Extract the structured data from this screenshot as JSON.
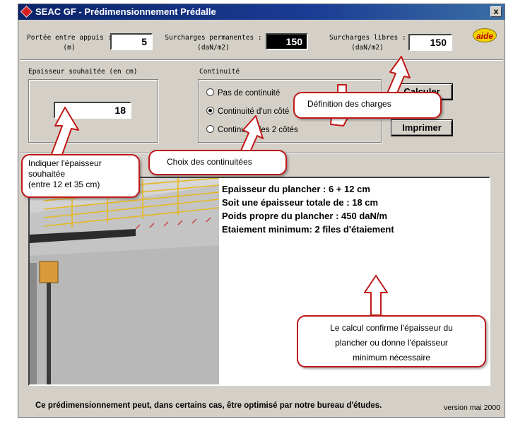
{
  "window": {
    "title": "SEAC GF - Prédimensionnement Prédalle",
    "close_label": "x"
  },
  "inputs": {
    "portee": {
      "label_line1": "Portée entre appuis :",
      "label_line2": "(m)",
      "value": "5"
    },
    "surcharges_permanentes": {
      "label_line1": "Surcharges permanentes :",
      "label_line2": "(daN/m2)",
      "value": "150"
    },
    "surcharges_libres": {
      "label_line1": "Surcharges libres :",
      "label_line2": "(daN/m2)",
      "value": "150"
    }
  },
  "aide_label": "aide",
  "epaisseur": {
    "label": "Epaisseur souhaitée (en cm)",
    "value": "18"
  },
  "continuite": {
    "label": "Continuité",
    "options": [
      {
        "label": "Pas de continuité",
        "selected": false
      },
      {
        "label": "Continuité d'un côté",
        "selected": true
      },
      {
        "label": "Continuité des 2 côtés",
        "selected": false
      }
    ]
  },
  "buttons": {
    "calculer": "Calculer",
    "imprimer": "Imprimer"
  },
  "results": [
    "Epaisseur du plancher : 6 + 12 cm",
    "Soit une épaisseur totale de : 18 cm",
    "Poids propre du plancher : 450 daN/m",
    "Etaiement minimum: 2 files d'étaiement"
  ],
  "footer": {
    "note": "Ce prédimensionnement peut, dans certains cas, être optimisé par notre bureau d'études.",
    "version": "version mai 2000"
  },
  "callouts": {
    "charges": "Définition des charges",
    "epaisseur_line1": "Indiquer l'épaisseur",
    "epaisseur_line2": "souhaitée",
    "epaisseur_line3": "(entre 12 et 35 cm)",
    "continuites": "Choix des continuitées",
    "calcul_line1": "Le calcul confirme l'épaisseur du",
    "calcul_line2": "plancher ou donne l'épaisseur",
    "calcul_line3": "minimum nécessaire"
  },
  "colors": {
    "titlebar": "#0a246a",
    "callout_border": "#c01818",
    "aide": "#f3d200"
  }
}
